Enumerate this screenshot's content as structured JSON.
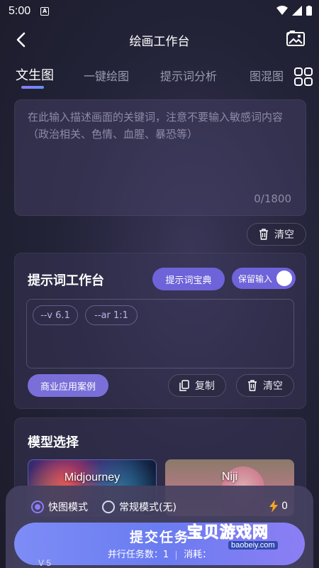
{
  "status_bar": {
    "time": "5:00",
    "notification_badge": "A"
  },
  "app_bar": {
    "title": "绘画工作台"
  },
  "tabs": [
    {
      "label": "文生图",
      "active": true
    },
    {
      "label": "一键绘图",
      "active": false
    },
    {
      "label": "提示词分析",
      "active": false
    },
    {
      "label": "图混图",
      "active": false
    }
  ],
  "prompt": {
    "placeholder": "在此输入描述画面的关键词，注意不要输入敏感词内容（政治相关、色情、血腥、暴恐等）",
    "counter": "0/1800",
    "clear_label": "清空"
  },
  "workbench": {
    "title": "提示词工作台",
    "dict_button": "提示词宝典",
    "keep_input_label": "保留输入",
    "keep_input_on": true,
    "tags": [
      "--v 6.1",
      "--ar 1:1"
    ],
    "case_button": "商业应用案例",
    "copy_label": "复制",
    "clear_label": "清空"
  },
  "models": {
    "title": "模型选择",
    "cards": [
      {
        "name": "Midjourney",
        "selected": true
      },
      {
        "name": "Niji",
        "selected": false
      }
    ],
    "version_label": "V 5"
  },
  "bottom": {
    "modes": [
      {
        "label": "快图模式",
        "selected": true
      },
      {
        "label": "常规模式(无)",
        "selected": false
      }
    ],
    "points_value": "0",
    "submit_label": "提交任务",
    "parallel_label": "并行任务数：1",
    "cost_label": "消耗："
  },
  "watermark": {
    "text": "宝贝游戏网",
    "url": "baobeiy.com"
  },
  "colors": {
    "accent": "#6e63d8",
    "background": "#24243a",
    "submit_gradient_start": "#7d8cf6"
  }
}
